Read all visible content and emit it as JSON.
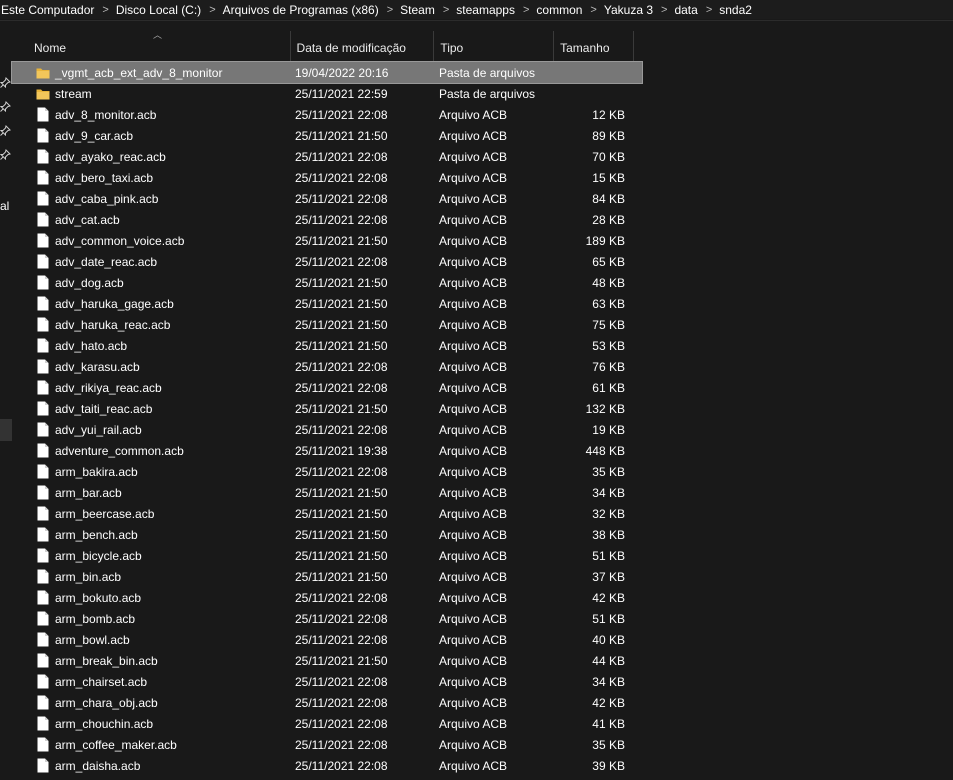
{
  "breadcrumb": [
    "Este Computador",
    "Disco Local (C:)",
    "Arquivos de Programas (x86)",
    "Steam",
    "steamapps",
    "common",
    "Yakuza 3",
    "data",
    "snda2"
  ],
  "breadcrumb_separator": ">",
  "nav": {
    "partial_label": "al"
  },
  "columns": {
    "name": "Nome",
    "date": "Data de modificação",
    "type": "Tipo",
    "size": "Tamanho"
  },
  "rows": [
    {
      "name": "_vgmt_acb_ext_adv_8_monitor",
      "date": "19/04/2022 20:16",
      "type": "Pasta de arquivos",
      "size": "",
      "kind": "folder",
      "selected": true
    },
    {
      "name": "stream",
      "date": "25/11/2021 22:59",
      "type": "Pasta de arquivos",
      "size": "",
      "kind": "folder"
    },
    {
      "name": "adv_8_monitor.acb",
      "date": "25/11/2021 22:08",
      "type": "Arquivo ACB",
      "size": "12 KB",
      "kind": "file"
    },
    {
      "name": "adv_9_car.acb",
      "date": "25/11/2021 21:50",
      "type": "Arquivo ACB",
      "size": "89 KB",
      "kind": "file"
    },
    {
      "name": "adv_ayako_reac.acb",
      "date": "25/11/2021 22:08",
      "type": "Arquivo ACB",
      "size": "70 KB",
      "kind": "file"
    },
    {
      "name": "adv_bero_taxi.acb",
      "date": "25/11/2021 22:08",
      "type": "Arquivo ACB",
      "size": "15 KB",
      "kind": "file"
    },
    {
      "name": "adv_caba_pink.acb",
      "date": "25/11/2021 22:08",
      "type": "Arquivo ACB",
      "size": "84 KB",
      "kind": "file"
    },
    {
      "name": "adv_cat.acb",
      "date": "25/11/2021 22:08",
      "type": "Arquivo ACB",
      "size": "28 KB",
      "kind": "file"
    },
    {
      "name": "adv_common_voice.acb",
      "date": "25/11/2021 21:50",
      "type": "Arquivo ACB",
      "size": "189 KB",
      "kind": "file"
    },
    {
      "name": "adv_date_reac.acb",
      "date": "25/11/2021 22:08",
      "type": "Arquivo ACB",
      "size": "65 KB",
      "kind": "file"
    },
    {
      "name": "adv_dog.acb",
      "date": "25/11/2021 21:50",
      "type": "Arquivo ACB",
      "size": "48 KB",
      "kind": "file"
    },
    {
      "name": "adv_haruka_gage.acb",
      "date": "25/11/2021 21:50",
      "type": "Arquivo ACB",
      "size": "63 KB",
      "kind": "file"
    },
    {
      "name": "adv_haruka_reac.acb",
      "date": "25/11/2021 21:50",
      "type": "Arquivo ACB",
      "size": "75 KB",
      "kind": "file"
    },
    {
      "name": "adv_hato.acb",
      "date": "25/11/2021 21:50",
      "type": "Arquivo ACB",
      "size": "53 KB",
      "kind": "file"
    },
    {
      "name": "adv_karasu.acb",
      "date": "25/11/2021 22:08",
      "type": "Arquivo ACB",
      "size": "76 KB",
      "kind": "file"
    },
    {
      "name": "adv_rikiya_reac.acb",
      "date": "25/11/2021 22:08",
      "type": "Arquivo ACB",
      "size": "61 KB",
      "kind": "file"
    },
    {
      "name": "adv_taiti_reac.acb",
      "date": "25/11/2021 21:50",
      "type": "Arquivo ACB",
      "size": "132 KB",
      "kind": "file"
    },
    {
      "name": "adv_yui_rail.acb",
      "date": "25/11/2021 22:08",
      "type": "Arquivo ACB",
      "size": "19 KB",
      "kind": "file"
    },
    {
      "name": "adventure_common.acb",
      "date": "25/11/2021 19:38",
      "type": "Arquivo ACB",
      "size": "448 KB",
      "kind": "file"
    },
    {
      "name": "arm_bakira.acb",
      "date": "25/11/2021 22:08",
      "type": "Arquivo ACB",
      "size": "35 KB",
      "kind": "file"
    },
    {
      "name": "arm_bar.acb",
      "date": "25/11/2021 21:50",
      "type": "Arquivo ACB",
      "size": "34 KB",
      "kind": "file"
    },
    {
      "name": "arm_beercase.acb",
      "date": "25/11/2021 21:50",
      "type": "Arquivo ACB",
      "size": "32 KB",
      "kind": "file"
    },
    {
      "name": "arm_bench.acb",
      "date": "25/11/2021 21:50",
      "type": "Arquivo ACB",
      "size": "38 KB",
      "kind": "file"
    },
    {
      "name": "arm_bicycle.acb",
      "date": "25/11/2021 21:50",
      "type": "Arquivo ACB",
      "size": "51 KB",
      "kind": "file"
    },
    {
      "name": "arm_bin.acb",
      "date": "25/11/2021 21:50",
      "type": "Arquivo ACB",
      "size": "37 KB",
      "kind": "file"
    },
    {
      "name": "arm_bokuto.acb",
      "date": "25/11/2021 22:08",
      "type": "Arquivo ACB",
      "size": "42 KB",
      "kind": "file"
    },
    {
      "name": "arm_bomb.acb",
      "date": "25/11/2021 22:08",
      "type": "Arquivo ACB",
      "size": "51 KB",
      "kind": "file"
    },
    {
      "name": "arm_bowl.acb",
      "date": "25/11/2021 22:08",
      "type": "Arquivo ACB",
      "size": "40 KB",
      "kind": "file"
    },
    {
      "name": "arm_break_bin.acb",
      "date": "25/11/2021 21:50",
      "type": "Arquivo ACB",
      "size": "44 KB",
      "kind": "file"
    },
    {
      "name": "arm_chairset.acb",
      "date": "25/11/2021 22:08",
      "type": "Arquivo ACB",
      "size": "34 KB",
      "kind": "file"
    },
    {
      "name": "arm_chara_obj.acb",
      "date": "25/11/2021 22:08",
      "type": "Arquivo ACB",
      "size": "42 KB",
      "kind": "file"
    },
    {
      "name": "arm_chouchin.acb",
      "date": "25/11/2021 22:08",
      "type": "Arquivo ACB",
      "size": "41 KB",
      "kind": "file"
    },
    {
      "name": "arm_coffee_maker.acb",
      "date": "25/11/2021 22:08",
      "type": "Arquivo ACB",
      "size": "35 KB",
      "kind": "file"
    },
    {
      "name": "arm_daisha.acb",
      "date": "25/11/2021 22:08",
      "type": "Arquivo ACB",
      "size": "39 KB",
      "kind": "file"
    }
  ],
  "icons": {
    "folder": "folder-icon",
    "file": "file-icon",
    "pin": "pin-icon",
    "sort": "sort-up-icon"
  },
  "colors": {
    "background": "#191919",
    "folder": "#e8b43a",
    "selected_row": "#777777"
  }
}
